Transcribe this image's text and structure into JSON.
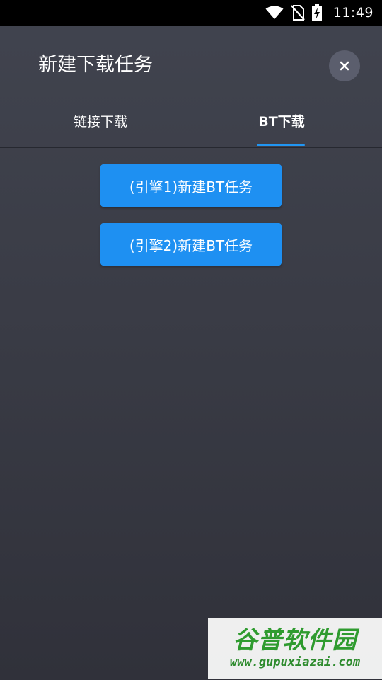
{
  "status_bar": {
    "time": "11:49",
    "icons": [
      "wifi-icon",
      "no-sim-icon",
      "battery-charging-icon"
    ]
  },
  "dialog": {
    "title": "新建下载任务",
    "close_icon": "close-icon"
  },
  "tabs": [
    {
      "label": "链接下载",
      "active": false
    },
    {
      "label": "BT下载",
      "active": true
    }
  ],
  "buttons": {
    "engine1_label": "(引擎1)新建BT任务",
    "engine2_label": "(引擎2)新建BT任务"
  },
  "watermark": {
    "title": "谷普软件园",
    "url": "www.gupuxiazai.com"
  },
  "colors": {
    "accent": "#1e90f2",
    "tab_indicator": "#2196f3",
    "background_top": "#41444f",
    "background_bottom": "#30313a",
    "close_button_bg": "#5b5e6d",
    "watermark_green": "#2f9b2f"
  }
}
